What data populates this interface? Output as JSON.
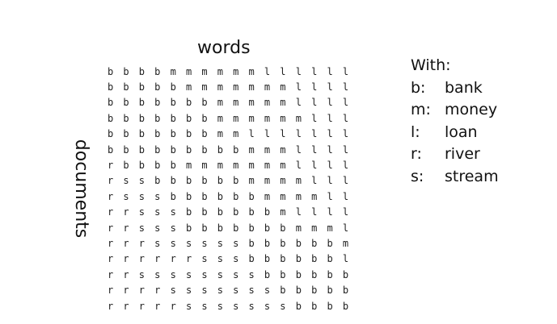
{
  "axis_labels": {
    "columns": "words",
    "rows": "documents"
  },
  "matrix": [
    [
      "b",
      "b",
      "b",
      "b",
      "m",
      "m",
      "m",
      "m",
      "m",
      "m",
      "l",
      "l",
      "l",
      "l",
      "l",
      "l"
    ],
    [
      "b",
      "b",
      "b",
      "b",
      "b",
      "m",
      "m",
      "m",
      "m",
      "m",
      "m",
      "m",
      "l",
      "l",
      "l",
      "l"
    ],
    [
      "b",
      "b",
      "b",
      "b",
      "b",
      "b",
      "b",
      "m",
      "m",
      "m",
      "m",
      "m",
      "l",
      "l",
      "l",
      "l"
    ],
    [
      "b",
      "b",
      "b",
      "b",
      "b",
      "b",
      "b",
      "m",
      "m",
      "m",
      "m",
      "m",
      "m",
      "l",
      "l",
      "l"
    ],
    [
      "b",
      "b",
      "b",
      "b",
      "b",
      "b",
      "b",
      "m",
      "m",
      "l",
      "l",
      "l",
      "l",
      "l",
      "l",
      "l"
    ],
    [
      "b",
      "b",
      "b",
      "b",
      "b",
      "b",
      "b",
      "b",
      "b",
      "m",
      "m",
      "m",
      "l",
      "l",
      "l",
      "l"
    ],
    [
      "r",
      "b",
      "b",
      "b",
      "b",
      "m",
      "m",
      "m",
      "m",
      "m",
      "m",
      "m",
      "l",
      "l",
      "l",
      "l"
    ],
    [
      "r",
      "s",
      "s",
      "b",
      "b",
      "b",
      "b",
      "b",
      "b",
      "m",
      "m",
      "m",
      "m",
      "l",
      "l",
      "l"
    ],
    [
      "r",
      "s",
      "s",
      "s",
      "b",
      "b",
      "b",
      "b",
      "b",
      "b",
      "m",
      "m",
      "m",
      "m",
      "l",
      "l"
    ],
    [
      "r",
      "r",
      "s",
      "s",
      "s",
      "b",
      "b",
      "b",
      "b",
      "b",
      "b",
      "m",
      "l",
      "l",
      "l",
      "l"
    ],
    [
      "r",
      "r",
      "s",
      "s",
      "s",
      "b",
      "b",
      "b",
      "b",
      "b",
      "b",
      "b",
      "m",
      "m",
      "m",
      "l"
    ],
    [
      "r",
      "r",
      "r",
      "s",
      "s",
      "s",
      "s",
      "s",
      "s",
      "b",
      "b",
      "b",
      "b",
      "b",
      "b",
      "m"
    ],
    [
      "r",
      "r",
      "r",
      "r",
      "r",
      "r",
      "s",
      "s",
      "s",
      "b",
      "b",
      "b",
      "b",
      "b",
      "b",
      "l"
    ],
    [
      "r",
      "r",
      "s",
      "s",
      "s",
      "s",
      "s",
      "s",
      "s",
      "s",
      "b",
      "b",
      "b",
      "b",
      "b",
      "b"
    ],
    [
      "r",
      "r",
      "r",
      "r",
      "s",
      "s",
      "s",
      "s",
      "s",
      "s",
      "s",
      "b",
      "b",
      "b",
      "b",
      "b"
    ],
    [
      "r",
      "r",
      "r",
      "r",
      "r",
      "s",
      "s",
      "s",
      "s",
      "s",
      "s",
      "s",
      "b",
      "b",
      "b",
      "b"
    ]
  ],
  "legend": {
    "title": "With:",
    "items": [
      {
        "key": "b:",
        "label": "bank"
      },
      {
        "key": "m:",
        "label": "money"
      },
      {
        "key": "l:",
        "label": "loan"
      },
      {
        "key": "r:",
        "label": "river"
      },
      {
        "key": "s:",
        "label": "stream"
      }
    ]
  }
}
